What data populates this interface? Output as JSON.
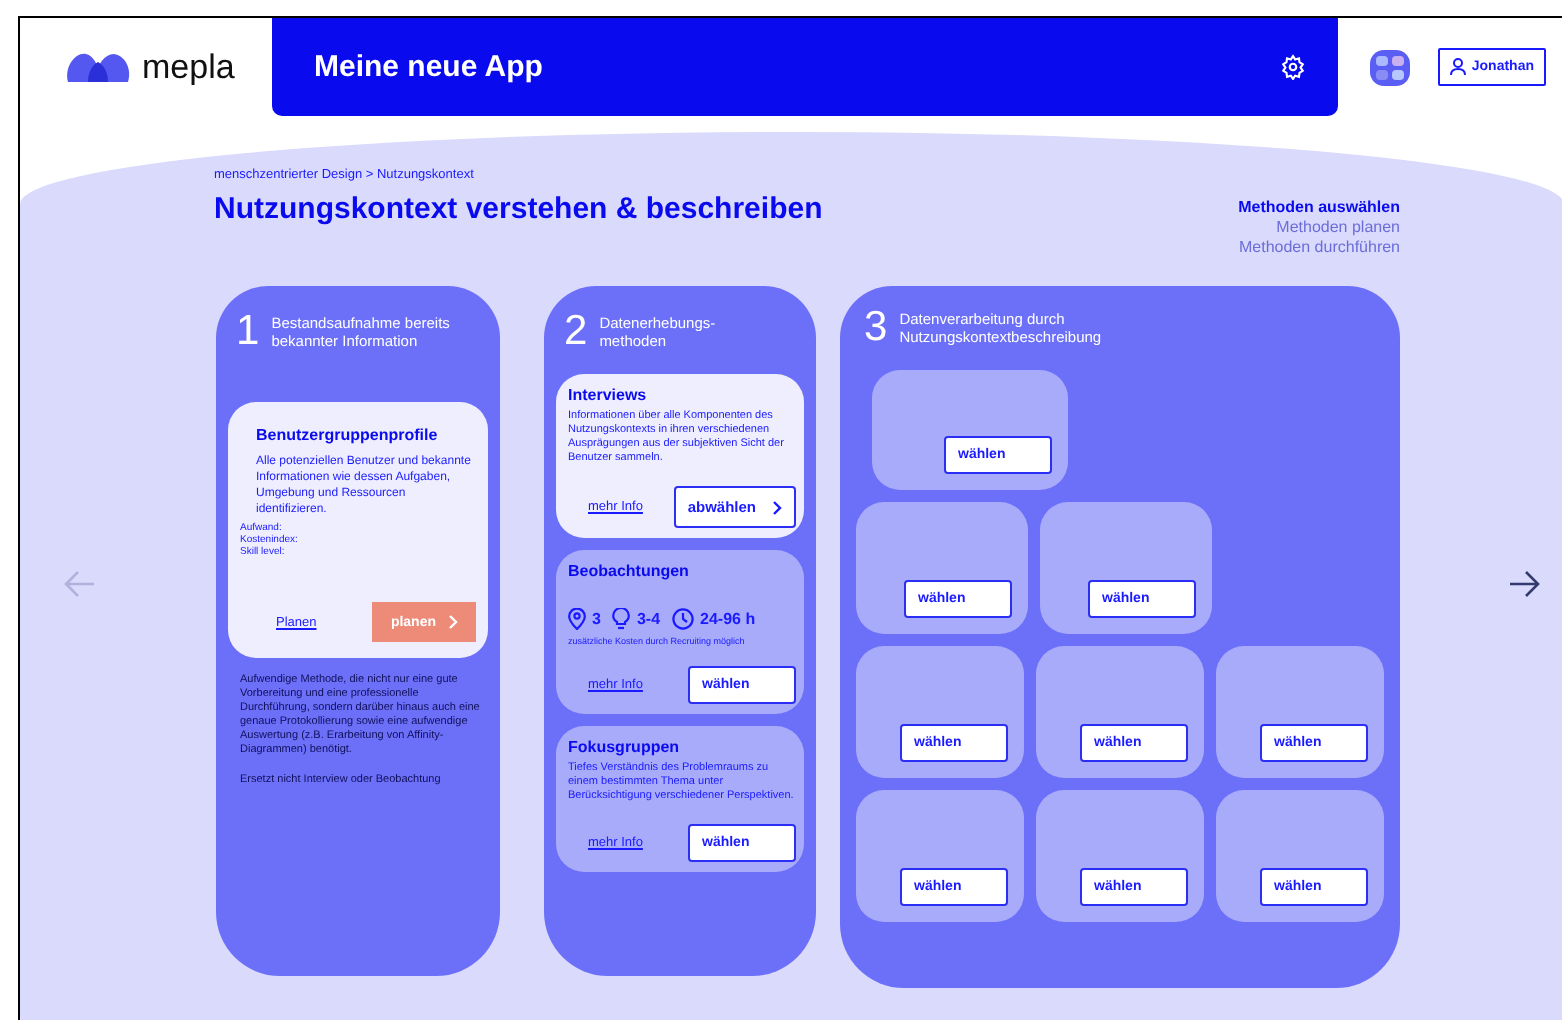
{
  "header": {
    "logo_text": "mepla",
    "title": "Meine neue App",
    "user": "Jonathan"
  },
  "breadcrumb": "menschzentrierter Design > Nutzungskontext",
  "page_title": "Nutzungskontext verstehen & beschreiben",
  "steps": [
    {
      "label": "Methoden auswählen",
      "selected": true
    },
    {
      "label": "Methoden planen",
      "selected": false
    },
    {
      "label": "Methoden durchführen",
      "selected": false
    }
  ],
  "phase1": {
    "number": "1",
    "title": "Bestandsaufnahme bereits bekannter Information",
    "card": {
      "title": "Benutzergruppenprofile",
      "description": "Alle potenziellen Benutzer und bekannte Informationen wie dessen Aufgaben, Umgebung und Ressourcen identifizieren.",
      "meta": [
        "Aufwand:",
        "Kostenindex:",
        "Skill level:"
      ],
      "link": "Planen",
      "button": "planen"
    },
    "note": "Aufwendige Methode, die nicht nur eine gute Vorbereitung und eine professionelle Durchführung, sondern darüber hinaus auch eine genaue Protokollierung sowie eine aufwendige Auswertung (z.B. Erarbeitung von Affinity-Diagrammen) benötigt.",
    "note_2": "Ersetzt nicht Interview oder Beobachtung"
  },
  "phase2": {
    "number": "2",
    "title": "Datenerhebungs-methoden",
    "methods": [
      {
        "title": "Interviews",
        "selected": true,
        "description": "Informationen über alle Komponenten des Nutzungskontexts in ihren verschiedenen Ausprägungen aus der subjektiven Sicht der Benutzer sammeln.",
        "link": "mehr Info",
        "button": "abwählen"
      },
      {
        "title": "Beobachtungen",
        "selected": false,
        "stats": [
          {
            "kind": "person",
            "value": "3"
          },
          {
            "kind": "idea",
            "value": "3-4"
          },
          {
            "kind": "time",
            "value": "24-96 h"
          }
        ],
        "stats_note": "zusätzliche Kosten durch Recruiting möglich",
        "link": "mehr Info",
        "button": "wählen"
      },
      {
        "title": "Fokusgruppen",
        "selected": false,
        "description": "Tiefes Verständnis des Problemraums zu einem bestimmten Thema unter Berücksichtigung verschiedener Perspektiven.",
        "link": "mehr Info",
        "button": "wählen"
      }
    ]
  },
  "phase3": {
    "number": "3",
    "title": "Datenverarbeitung durch Nutzungskontextbeschreibung",
    "rows": [
      [
        "wählen"
      ],
      [
        "wählen",
        "wählen"
      ],
      [
        "wählen",
        "wählen",
        "wählen"
      ],
      [
        "wählen",
        "wählen",
        "wählen"
      ]
    ]
  }
}
